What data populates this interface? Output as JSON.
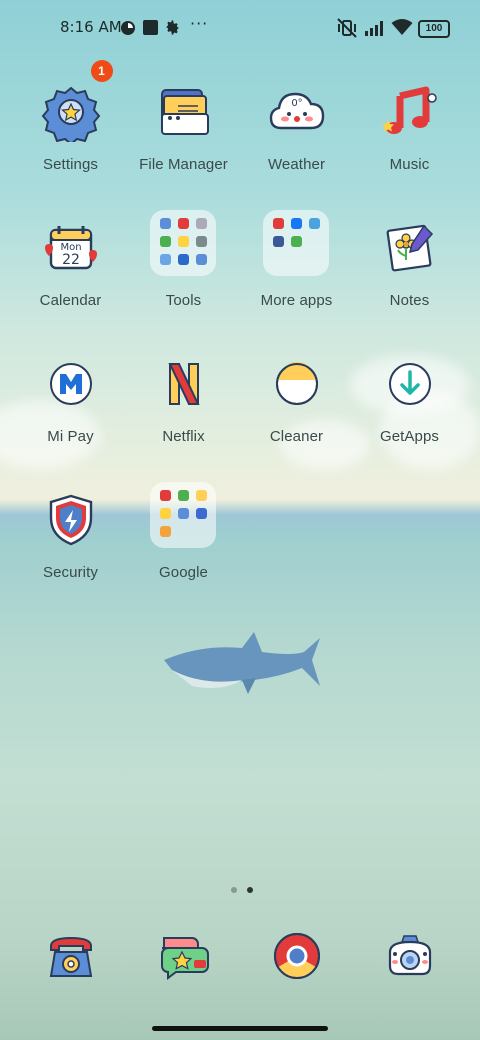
{
  "status_bar": {
    "time": "8:16 AM",
    "battery": "100",
    "more": "···",
    "left_icons": [
      "circle-app-icon",
      "square-app-icon",
      "gear-icon",
      "more-icon"
    ],
    "right_icons": [
      "vibrate-off-icon",
      "signal-icon",
      "wifi-icon",
      "battery-icon"
    ]
  },
  "apps": [
    {
      "id": "settings",
      "label": "Settings",
      "badge": "1",
      "icon": "gear-icon"
    },
    {
      "id": "file-manager",
      "label": "File Manager",
      "icon": "folder-icon"
    },
    {
      "id": "weather",
      "label": "Weather",
      "icon": "cloud-icon",
      "icon_text": "0°"
    },
    {
      "id": "music",
      "label": "Music",
      "icon": "music-note-icon"
    },
    {
      "id": "calendar",
      "label": "Calendar",
      "icon": "calendar-icon",
      "icon_day": "Mon",
      "icon_date": "22"
    },
    {
      "id": "tools",
      "label": "Tools",
      "icon": "folder-icon"
    },
    {
      "id": "more-apps",
      "label": "More apps",
      "icon": "folder-icon"
    },
    {
      "id": "notes",
      "label": "Notes",
      "icon": "note-icon"
    },
    {
      "id": "mi-pay",
      "label": "Mi Pay",
      "icon": "mi-pay-icon"
    },
    {
      "id": "netflix",
      "label": "Netflix",
      "icon": "netflix-icon"
    },
    {
      "id": "cleaner",
      "label": "Cleaner",
      "icon": "cleaner-icon"
    },
    {
      "id": "getapps",
      "label": "GetApps",
      "icon": "download-icon"
    },
    {
      "id": "security",
      "label": "Security",
      "icon": "shield-icon"
    },
    {
      "id": "google",
      "label": "Google",
      "icon": "folder-icon"
    }
  ],
  "page_indicator": {
    "pages": 2,
    "current": 2
  },
  "dock": [
    {
      "id": "phone",
      "icon": "phone-icon"
    },
    {
      "id": "messages",
      "icon": "message-icon"
    },
    {
      "id": "chrome",
      "icon": "chrome-icon"
    },
    {
      "id": "camera",
      "icon": "camera-icon"
    }
  ],
  "colors": {
    "badge": "#f04a17",
    "label": "#3a4a4a",
    "dot_active": "#2b3535",
    "dot_inactive": "#8a9797"
  }
}
